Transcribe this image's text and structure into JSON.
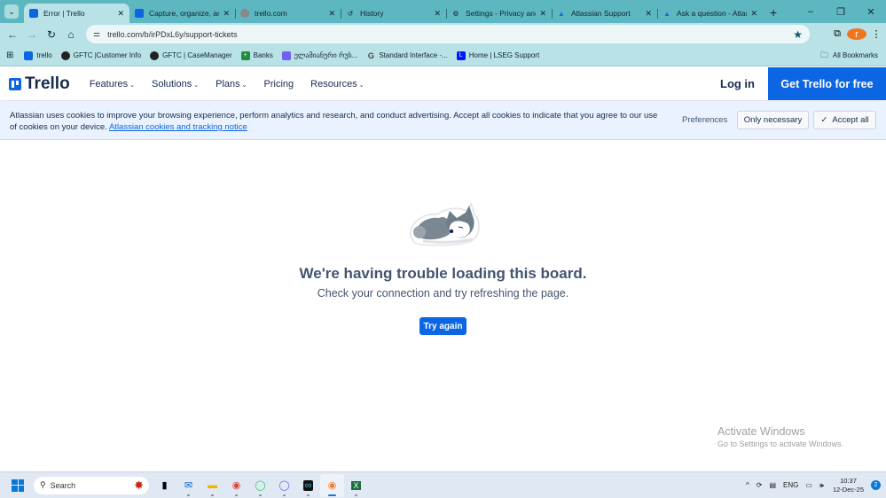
{
  "browser": {
    "tabs": [
      {
        "title": "Error | Trello",
        "icon": "trello-icon",
        "active": true
      },
      {
        "title": "Capture, organize, and",
        "icon": "trello-icon"
      },
      {
        "title": "trello.com",
        "icon": "globe-icon"
      },
      {
        "title": "History",
        "icon": "history-icon"
      },
      {
        "title": "Settings - Privacy and s",
        "icon": "gear-icon"
      },
      {
        "title": "Atlassian Support",
        "icon": "atlassian-icon"
      },
      {
        "title": "Ask a question - Atlass",
        "icon": "atlassian-icon"
      }
    ],
    "url": "trello.com/b/irPDxL6y/support-tickets",
    "profile_initial": "r",
    "bookmarks": [
      {
        "label": "trello",
        "icon": "trello-icon",
        "color": "#0c66e4"
      },
      {
        "label": "GFTC |Customer Info",
        "icon": "globe-icon",
        "color": "#222"
      },
      {
        "label": "GFTC | CaseManager",
        "icon": "globe-icon",
        "color": "#222"
      },
      {
        "label": "Banks",
        "icon": "sheets-icon",
        "color": "#1e8e3e"
      },
      {
        "label": "ელამიანური რუს...",
        "icon": "viber-icon",
        "color": "#7360f2"
      },
      {
        "label": "Standard Interface -...",
        "icon": "g-icon",
        "color": "#444"
      },
      {
        "label": "Home | LSEG Support",
        "icon": "lseg-icon",
        "color": "#0018ff"
      }
    ],
    "all_bookmarks": "All Bookmarks"
  },
  "trello_nav": {
    "logo": "Trello",
    "menu": [
      "Features",
      "Solutions",
      "Plans",
      "Pricing",
      "Resources"
    ],
    "login": "Log in",
    "cta": "Get Trello for free"
  },
  "cookie_banner": {
    "text": "Atlassian uses cookies to improve your browsing experience, perform analytics and research, and conduct advertising. Accept all cookies to indicate that you agree to our use of cookies on your device.",
    "link": "Atlassian cookies and tracking notice",
    "preferences": "Preferences",
    "only_necessary": "Only necessary",
    "accept_all": "Accept all"
  },
  "error": {
    "title": "We're having trouble loading this board.",
    "subtitle": "Check your connection and try refreshing the page.",
    "button": "Try again"
  },
  "watermark": {
    "line1": "Activate Windows",
    "line2": "Go to Settings to activate Windows."
  },
  "taskbar": {
    "search": "Search",
    "language": "ENG",
    "time": "10:37",
    "date": "12-Dec-25",
    "notifications": "2"
  }
}
